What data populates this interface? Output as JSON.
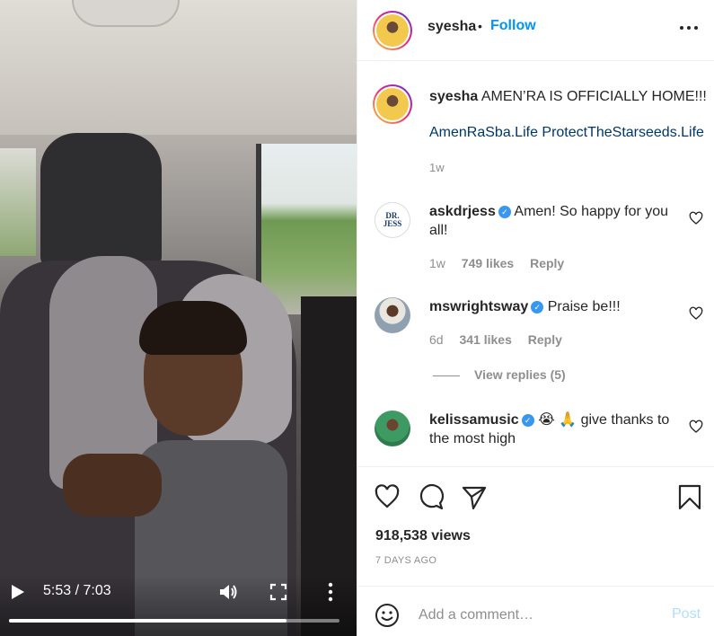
{
  "post": {
    "username": "syesha",
    "separator": "•",
    "follow_label": "Follow",
    "more_icon": "more-horizontal-icon"
  },
  "video": {
    "time_display": "5:53 / 7:03",
    "progress": 0.84,
    "play_icon": "play-icon",
    "volume_icon": "volume-icon",
    "fullscreen_icon": "fullscreen-icon",
    "menu_icon": "more-vertical-icon"
  },
  "caption": {
    "username": "syesha",
    "text": "AMEN’RA IS OFFICIALLY HOME!!!",
    "links": "AmenRaSba.Life ProtectTheStarseeds.Life",
    "time": "1w"
  },
  "comments": [
    {
      "username": "askdrjess",
      "verified": true,
      "text": "Amen! So happy for you all!",
      "time": "1w",
      "likes": "749 likes",
      "reply_label": "Reply",
      "avatar_text": "DR. JESS"
    },
    {
      "username": "mswrightsway",
      "verified": true,
      "text": "Praise be!!!",
      "time": "6d",
      "likes": "341 likes",
      "reply_label": "Reply"
    },
    {
      "username": "kelissamusic",
      "verified": true,
      "text": "😭 🙏 give thanks to the most high"
    }
  ],
  "view_replies": "View replies (5)",
  "stats": {
    "views": "918,538 views",
    "date": "7 DAYS AGO"
  },
  "add_comment": {
    "placeholder": "Add a comment…",
    "post_label": "Post"
  },
  "colors": {
    "link_blue": "#00376b",
    "follow_blue": "#0095f6",
    "verified_blue": "#3897f0",
    "muted": "#8e8e8e",
    "post_disabled": "#b2dffc"
  }
}
